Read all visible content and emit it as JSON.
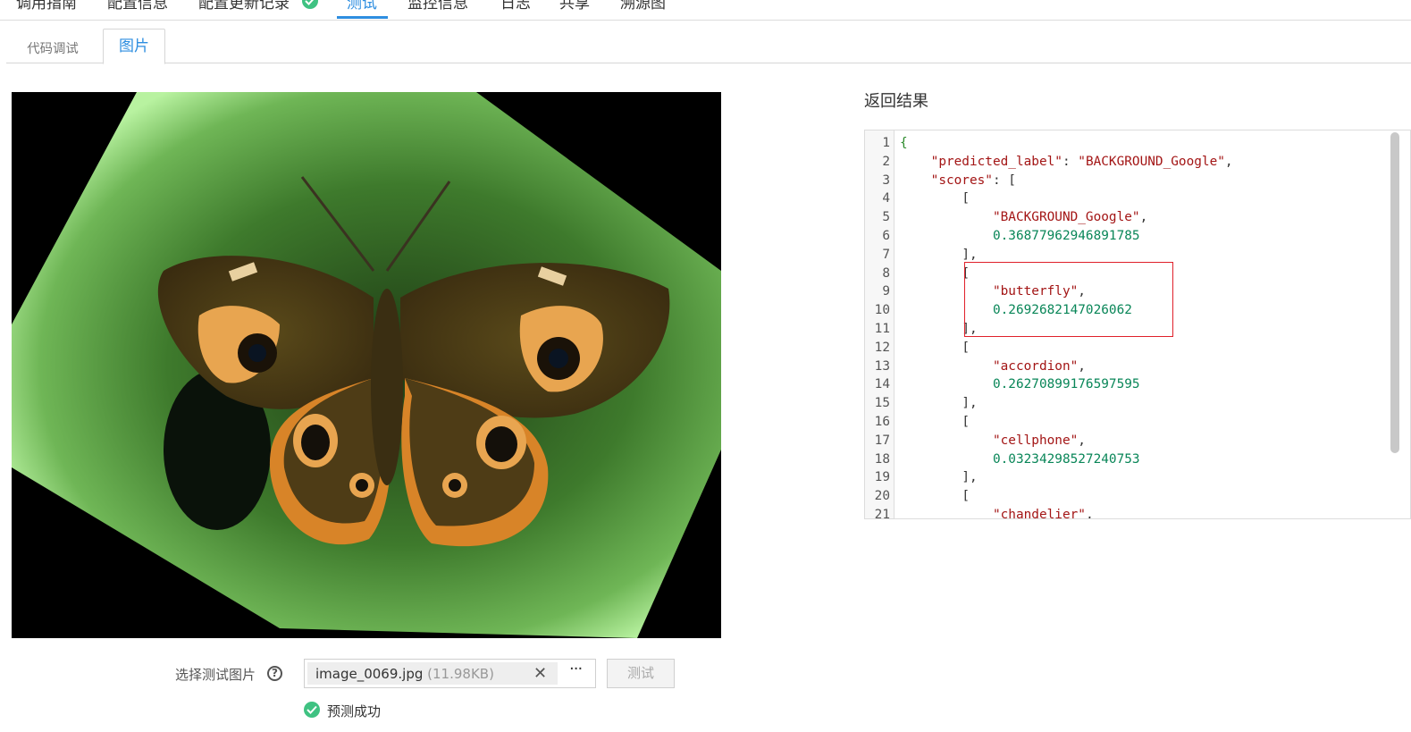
{
  "top_tabs": [
    {
      "label": "调用指南",
      "active": false
    },
    {
      "label": "配置信息",
      "active": false
    },
    {
      "label": "配置更新记录",
      "active": false
    },
    {
      "label": "测试",
      "active": true
    },
    {
      "label": "监控信息",
      "active": false
    },
    {
      "label": "日志",
      "active": false
    },
    {
      "label": "共享",
      "active": false
    },
    {
      "label": "溯源图",
      "active": false
    }
  ],
  "sub_tabs": [
    {
      "label": "代码调试",
      "active": false
    },
    {
      "label": "图片",
      "active": true
    }
  ],
  "form": {
    "select_label": "选择测试图片",
    "help_glyph": "?",
    "file_name": "image_0069.jpg",
    "file_size": "(11.98KB)",
    "remove_glyph": "✕",
    "more_glyph": "···",
    "test_button": "测试",
    "status": "预测成功"
  },
  "result": {
    "title": "返回结果",
    "lines": [
      {
        "n": "1",
        "indent": "",
        "parts": [
          {
            "t": "{",
            "k": "brace"
          }
        ]
      },
      {
        "n": "2",
        "indent": "    ",
        "parts": [
          {
            "t": "\"predicted_label\"",
            "k": "str"
          },
          {
            "t": ": ",
            "k": "p"
          },
          {
            "t": "\"BACKGROUND_Google\"",
            "k": "str"
          },
          {
            "t": ",",
            "k": "p"
          }
        ]
      },
      {
        "n": "3",
        "indent": "    ",
        "parts": [
          {
            "t": "\"scores\"",
            "k": "str"
          },
          {
            "t": ": [",
            "k": "p"
          }
        ]
      },
      {
        "n": "4",
        "indent": "        ",
        "parts": [
          {
            "t": "[",
            "k": "p"
          }
        ]
      },
      {
        "n": "5",
        "indent": "            ",
        "parts": [
          {
            "t": "\"BACKGROUND_Google\"",
            "k": "str"
          },
          {
            "t": ",",
            "k": "p"
          }
        ]
      },
      {
        "n": "6",
        "indent": "            ",
        "parts": [
          {
            "t": "0.36877962946891785",
            "k": "num"
          }
        ]
      },
      {
        "n": "7",
        "indent": "        ",
        "parts": [
          {
            "t": "],",
            "k": "p"
          }
        ]
      },
      {
        "n": "8",
        "indent": "        ",
        "parts": [
          {
            "t": "[",
            "k": "p"
          }
        ]
      },
      {
        "n": "9",
        "indent": "            ",
        "parts": [
          {
            "t": "\"butterfly\"",
            "k": "str"
          },
          {
            "t": ",",
            "k": "p"
          }
        ]
      },
      {
        "n": "10",
        "indent": "            ",
        "parts": [
          {
            "t": "0.2692682147026062",
            "k": "num"
          }
        ]
      },
      {
        "n": "11",
        "indent": "        ",
        "parts": [
          {
            "t": "],",
            "k": "p"
          }
        ]
      },
      {
        "n": "12",
        "indent": "        ",
        "parts": [
          {
            "t": "[",
            "k": "p"
          }
        ]
      },
      {
        "n": "13",
        "indent": "            ",
        "parts": [
          {
            "t": "\"accordion\"",
            "k": "str"
          },
          {
            "t": ",",
            "k": "p"
          }
        ]
      },
      {
        "n": "14",
        "indent": "            ",
        "parts": [
          {
            "t": "0.26270899176597595",
            "k": "num"
          }
        ]
      },
      {
        "n": "15",
        "indent": "        ",
        "parts": [
          {
            "t": "],",
            "k": "p"
          }
        ]
      },
      {
        "n": "16",
        "indent": "        ",
        "parts": [
          {
            "t": "[",
            "k": "p"
          }
        ]
      },
      {
        "n": "17",
        "indent": "            ",
        "parts": [
          {
            "t": "\"cellphone\"",
            "k": "str"
          },
          {
            "t": ",",
            "k": "p"
          }
        ]
      },
      {
        "n": "18",
        "indent": "            ",
        "parts": [
          {
            "t": "0.03234298527240753",
            "k": "num"
          }
        ]
      },
      {
        "n": "19",
        "indent": "        ",
        "parts": [
          {
            "t": "],",
            "k": "p"
          }
        ]
      },
      {
        "n": "20",
        "indent": "        ",
        "parts": [
          {
            "t": "[",
            "k": "p"
          }
        ]
      },
      {
        "n": "21",
        "indent": "            ",
        "parts": [
          {
            "t": "\"chandelier\"",
            "k": "str"
          },
          {
            "t": ",",
            "k": "p"
          }
        ]
      }
    ]
  },
  "colors": {
    "accent": "#2e8ee0",
    "success": "#3fc282",
    "highlight_border": "#e0202a"
  }
}
